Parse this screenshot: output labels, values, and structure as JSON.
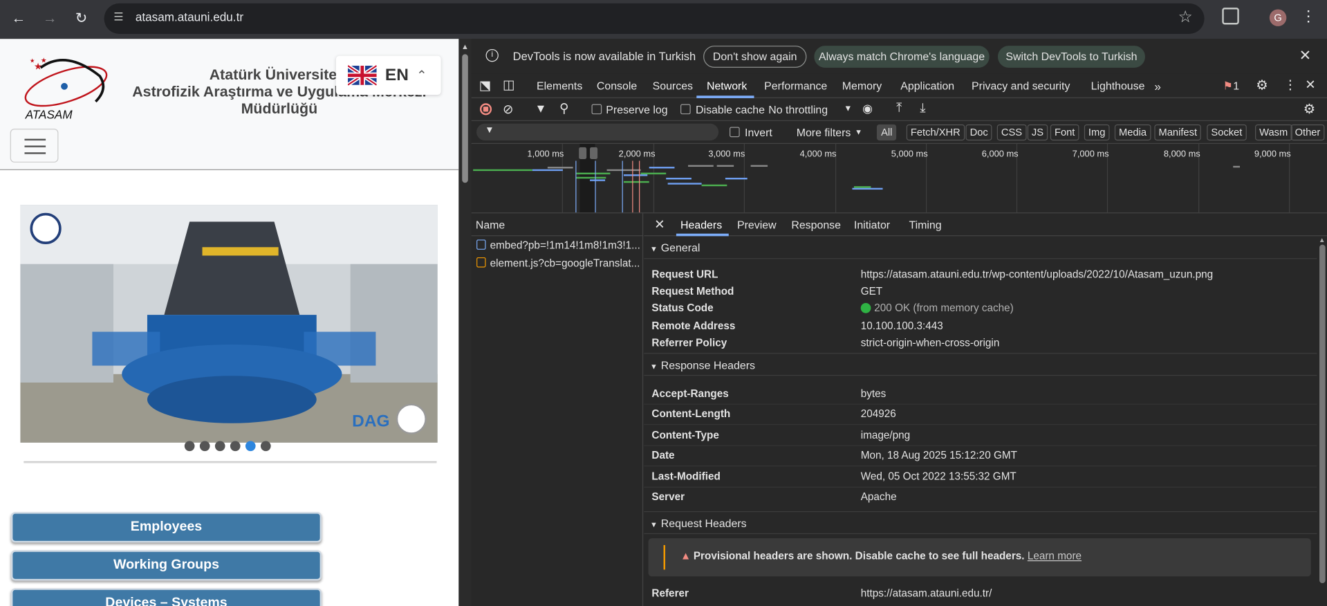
{
  "browser": {
    "url": "atasam.atauni.edu.tr",
    "profile_initial": "G"
  },
  "site": {
    "logo_text": "ATASAM",
    "title_line1": "Atatürk Üniversitesi",
    "title_line2": "Astrofizik Araştırma ve Uygulama Merkezi",
    "title_line3": "Müdürlüğü",
    "language_code": "EN",
    "slider_badge": "DAG",
    "slide_dots": 6,
    "active_dot": 5,
    "buttons": [
      "Employees",
      "Working Groups",
      "Devices – Systems"
    ],
    "button_color": "#3f79a6"
  },
  "devtools": {
    "infobar": {
      "message": "DevTools is now available in Turkish",
      "dont_show": "Don't show again",
      "match_language": "Always match Chrome's language",
      "switch": "Switch DevTools to Turkish"
    },
    "tabs": [
      "Elements",
      "Console",
      "Sources",
      "Network",
      "Performance",
      "Memory",
      "Application",
      "Privacy and security",
      "Lighthouse"
    ],
    "active_tab": "Network",
    "issues_count": "1",
    "toolbar": {
      "preserve_log": "Preserve log",
      "disable_cache": "Disable cache",
      "throttling": "No throttling"
    },
    "filter": {
      "invert": "Invert",
      "more_filters": "More filters",
      "types": [
        "All",
        "Fetch/XHR",
        "Doc",
        "CSS",
        "JS",
        "Font",
        "Img",
        "Media",
        "Manifest",
        "Socket",
        "Wasm",
        "Other"
      ]
    },
    "timeline_ticks": [
      "1,000 ms",
      "2,000 ms",
      "3,000 ms",
      "4,000 ms",
      "5,000 ms",
      "6,000 ms",
      "7,000 ms",
      "8,000 ms",
      "9,000 ms"
    ],
    "requests": {
      "header": "Name",
      "items": [
        "embed?pb=!1m14!1m8!1m3!1...",
        "element.js?cb=googleTranslat..."
      ]
    },
    "detail_tabs": [
      "Headers",
      "Preview",
      "Response",
      "Initiator",
      "Timing"
    ],
    "general": {
      "title": "General",
      "rows": [
        {
          "k": "Request URL",
          "v": "https://atasam.atauni.edu.tr/wp-content/uploads/2022/10/Atasam_uzun.png"
        },
        {
          "k": "Request Method",
          "v": "GET"
        },
        {
          "k": "Status Code",
          "v": "200 OK (from memory cache)"
        },
        {
          "k": "Remote Address",
          "v": "10.100.100.3:443"
        },
        {
          "k": "Referrer Policy",
          "v": "strict-origin-when-cross-origin"
        }
      ]
    },
    "response_headers": {
      "title": "Response Headers",
      "rows": [
        {
          "k": "Accept-Ranges",
          "v": "bytes"
        },
        {
          "k": "Content-Length",
          "v": "204926"
        },
        {
          "k": "Content-Type",
          "v": "image/png"
        },
        {
          "k": "Date",
          "v": "Mon, 18 Aug 2025 15:12:20 GMT"
        },
        {
          "k": "Last-Modified",
          "v": "Wed, 05 Oct 2022 13:55:32 GMT"
        },
        {
          "k": "Server",
          "v": "Apache"
        }
      ]
    },
    "request_headers": {
      "title": "Request Headers",
      "warning": "Provisional headers are shown. Disable cache to see full headers.",
      "learn_more": "Learn more",
      "rows": [
        {
          "k": "Referer",
          "v": "https://atasam.atauni.edu.tr/"
        }
      ]
    }
  }
}
